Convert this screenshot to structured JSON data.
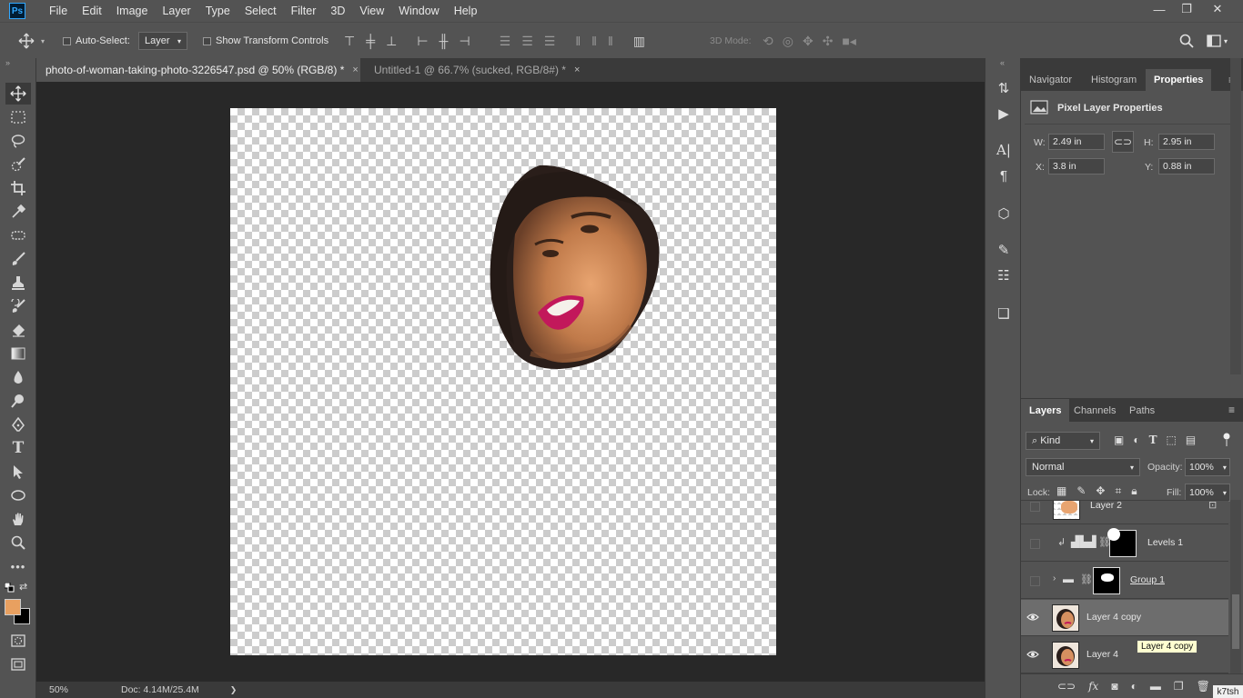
{
  "app": {
    "logo": "Ps"
  },
  "menu": [
    "File",
    "Edit",
    "Image",
    "Layer",
    "Type",
    "Select",
    "Filter",
    "3D",
    "View",
    "Window",
    "Help"
  ],
  "window_controls": {
    "minimize": "—",
    "restore": "❐",
    "close": "✕"
  },
  "options_bar": {
    "auto_select_label": "Auto-Select:",
    "auto_select_target": "Layer",
    "show_transform_label": "Show Transform Controls",
    "mode_3d_label": "3D Mode:"
  },
  "tabs": [
    {
      "label": "photo-of-woman-taking-photo-3226547.psd @ 50% (RGB/8) *",
      "close": "×",
      "active": true
    },
    {
      "label": "Untitled-1 @ 66.7% (sucked, RGB/8#) *",
      "close": "×",
      "active": false
    }
  ],
  "status": {
    "zoom": "50%",
    "doc": "Doc: 4.14M/25.4M",
    "arrow": "❯"
  },
  "colors": {
    "foreground": "#e8a060",
    "background": "#000000",
    "canvas_bg": "#282828",
    "panel_bg": "#535353",
    "accent": "#31a8ff"
  },
  "top_panel": {
    "tabs": [
      "Navigator",
      "Histogram",
      "Properties"
    ],
    "active_tab": "Properties",
    "title": "Pixel Layer Properties",
    "w_label": "W:",
    "w_value": "2.49 in",
    "h_label": "H:",
    "h_value": "2.95 in",
    "x_label": "X:",
    "x_value": "3.8 in",
    "y_label": "Y:",
    "y_value": "0.88 in"
  },
  "layers_panel": {
    "tabs": [
      "Layers",
      "Channels",
      "Paths"
    ],
    "active_tab": "Layers",
    "filter_label": "Kind",
    "blend_mode": "Normal",
    "opacity_label": "Opacity:",
    "opacity_value": "100%",
    "lock_label": "Lock:",
    "fill_label": "Fill:",
    "fill_value": "100%",
    "layers": [
      {
        "name": "Layer 2",
        "visible": false,
        "selected": false
      },
      {
        "name": "Levels 1",
        "visible": false,
        "selected": false
      },
      {
        "name": "Group 1",
        "visible": false,
        "selected": false
      },
      {
        "name": "Layer 4 copy",
        "visible": true,
        "selected": true
      },
      {
        "name": "Layer 4",
        "visible": true,
        "selected": false
      }
    ],
    "tooltip": "Layer 4 copy",
    "footer_fx": "fx"
  },
  "corner_badge": "k7tsh"
}
